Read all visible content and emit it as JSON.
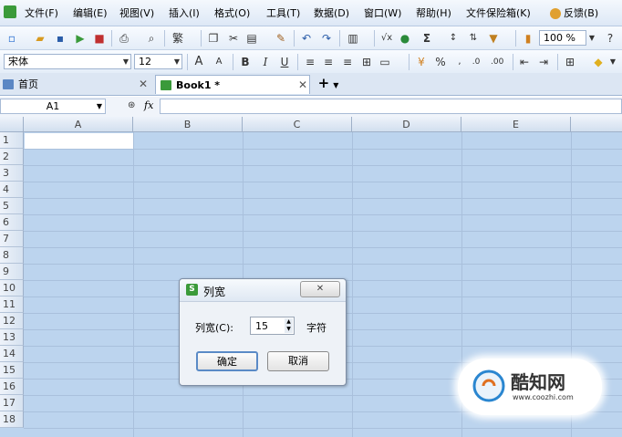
{
  "menu": {
    "items": [
      "文件(F)",
      "编辑(E)",
      "视图(V)",
      "插入(I)",
      "格式(O)",
      "工具(T)",
      "数据(D)",
      "窗口(W)",
      "帮助(H)",
      "文件保险箱(K)",
      "反馈(B)"
    ]
  },
  "toolbar": {
    "zoom": "100 %",
    "sum_symbol": "Σ"
  },
  "format": {
    "font_name": "宋体",
    "font_size": "12",
    "bold": "B",
    "italic": "I",
    "underline": "U",
    "percent": "%"
  },
  "tabs": [
    {
      "label": "首页"
    },
    {
      "label": "Book1 *"
    }
  ],
  "formula": {
    "cell_ref": "A1",
    "fx": "fx",
    "value": ""
  },
  "grid": {
    "columns": [
      "A",
      "B",
      "C",
      "D",
      "E"
    ],
    "rows": [
      "1",
      "2",
      "3",
      "4",
      "5",
      "6",
      "7",
      "8",
      "9",
      "10",
      "11",
      "12",
      "13",
      "14",
      "15",
      "16",
      "17",
      "18"
    ]
  },
  "dialog": {
    "title": "列宽",
    "label": "列宽(C):",
    "value": "15",
    "unit": "字符",
    "ok": "确定",
    "cancel": "取消",
    "close": "✕"
  },
  "watermark": {
    "brand": "酷知网",
    "url": "www.coozhi.com"
  },
  "colors": {
    "selection": "#bcd4ee",
    "gridline": "#a9c0dc",
    "brand_green": "#3a9a3a"
  }
}
